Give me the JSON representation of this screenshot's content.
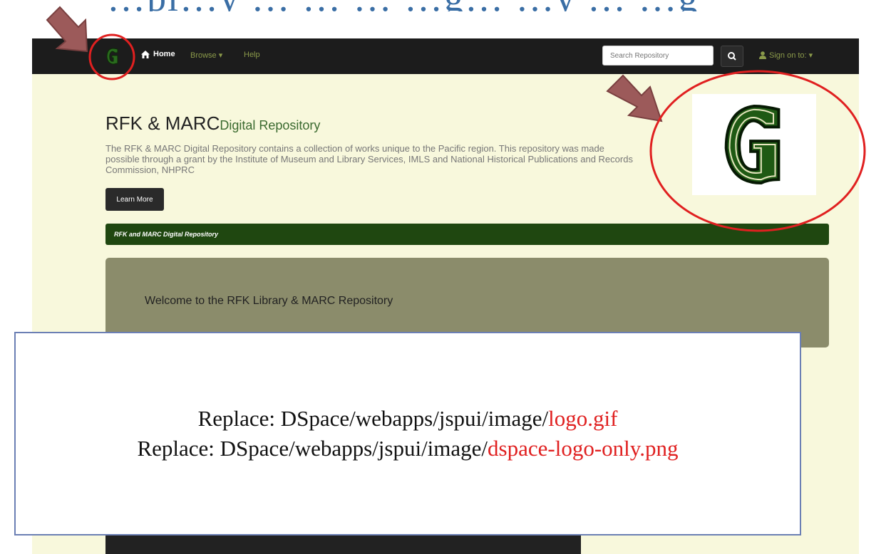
{
  "slide": {
    "title_fragment": "…pl…y …  …  … …g… …y … …g"
  },
  "navbar": {
    "logo_icon": "g-logo-icon",
    "home_label": "Home",
    "browse_label": "Browse ▾",
    "help_label": "Help",
    "search_placeholder": "Search Repository",
    "signon_label": "Sign on to: ▾"
  },
  "hero": {
    "title": "RFK & MARC",
    "title_sub": "Digital Repository",
    "description": "The RFK & MARC Digital Repository contains a collection of works unique to the Pacific region. This repository was made possible through a grant by the Institute of Museum and Library Services, IMLS and National Historical Publications and Records Commission, NHPRC",
    "learn_more": "Learn More"
  },
  "breadcrumb": "RFK and MARC Digital Repository",
  "welcome": "Welcome to the RFK Library & MARC Repository",
  "overlay": {
    "line1_prefix": "Replace: DSpace/webapps/jspui/image/",
    "line1_highlight": "logo.gif",
    "line2_prefix": "Replace: DSpace/webapps/jspui/image/",
    "line2_highlight": "dspace-logo-only.png"
  },
  "colors": {
    "navbar": "#1c1c1c",
    "page_bg": "#f8f8dc",
    "brand_green": "#1f4710",
    "welcome_bg": "#8b8c6b",
    "highlight_red": "#e02020",
    "arrow": "#9c5a5a"
  }
}
